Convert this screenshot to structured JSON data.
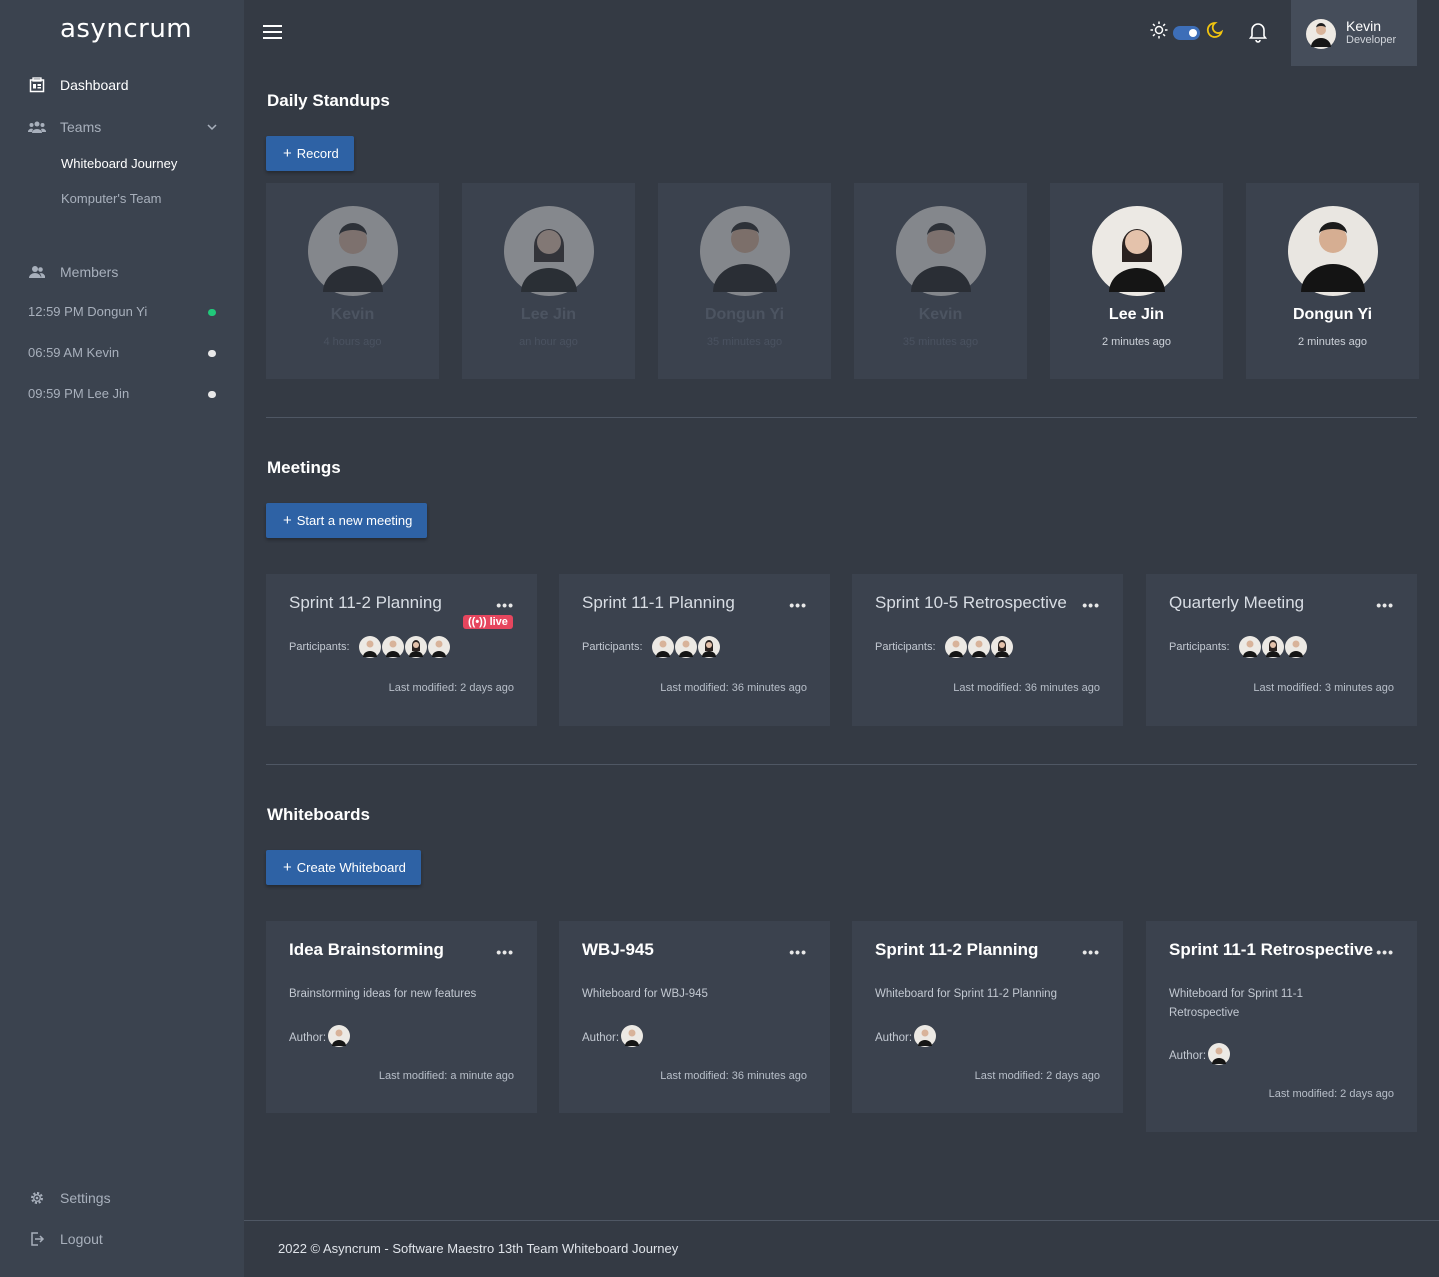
{
  "app": {
    "logo": "asyncrum"
  },
  "sidebar": {
    "dashboard": "Dashboard",
    "teams": "Teams",
    "team_items": [
      "Whiteboard Journey",
      "Komputer's Team"
    ],
    "members_label": "Members",
    "members": [
      {
        "text": "12:59 PM Dongun Yi",
        "status": "online"
      },
      {
        "text": "06:59 AM Kevin",
        "status": "away"
      },
      {
        "text": "09:59 PM Lee Jin",
        "status": "away"
      }
    ],
    "settings": "Settings",
    "logout": "Logout"
  },
  "header": {
    "user_name": "Kevin",
    "user_role": "Developer",
    "theme_icons": [
      "sun-icon",
      "moon-icon"
    ],
    "accent": "#2e62a5"
  },
  "standups": {
    "title": "Daily Standups",
    "record_label": "Record",
    "cards": [
      {
        "name": "Kevin",
        "time": "4 hours ago",
        "watched": true
      },
      {
        "name": "Lee Jin",
        "time": "an hour ago",
        "watched": true
      },
      {
        "name": "Dongun Yi",
        "time": "35 minutes ago",
        "watched": true
      },
      {
        "name": "Kevin",
        "time": "35 minutes ago",
        "watched": true
      },
      {
        "name": "Lee Jin",
        "time": "2 minutes ago",
        "watched": false
      },
      {
        "name": "Dongun Yi",
        "time": "2 minutes ago",
        "watched": false
      }
    ]
  },
  "meetings": {
    "title": "Meetings",
    "new_label": "Start a new meeting",
    "participants_label": "Participants:",
    "cards": [
      {
        "title": "Sprint 11-2 Planning",
        "live": "live",
        "participants": 4,
        "modified": "Last modified: 2 days ago"
      },
      {
        "title": "Sprint 11-1 Planning",
        "participants": 3,
        "modified": "Last modified: 36 minutes ago"
      },
      {
        "title": "Sprint 10-5 Retrospective",
        "participants": 3,
        "modified": "Last modified: 36 minutes ago"
      },
      {
        "title": "Quarterly Meeting",
        "participants": 3,
        "modified": "Last modified: 3 minutes ago"
      }
    ]
  },
  "whiteboards": {
    "title": "Whiteboards",
    "new_label": "Create Whiteboard",
    "author_label": "Author:",
    "cards": [
      {
        "title": "Idea Brainstorming",
        "desc": "Brainstorming ideas for new features",
        "modified": "Last modified: a minute ago"
      },
      {
        "title": "WBJ-945",
        "desc": "Whiteboard for WBJ-945",
        "modified": "Last modified: 36 minutes ago"
      },
      {
        "title": "Sprint 11-2 Planning",
        "desc": "Whiteboard for Sprint 11-2 Planning",
        "modified": "Last modified: 2 days ago"
      },
      {
        "title": "Sprint 11-1 Retrospective",
        "desc": "Whiteboard for Sprint 11-1 Retrospective",
        "modified": "Last modified: 2 days ago"
      }
    ]
  },
  "footer": {
    "text": "2022 © Asyncrum - Software Maestro 13th Team Whiteboard Journey"
  }
}
